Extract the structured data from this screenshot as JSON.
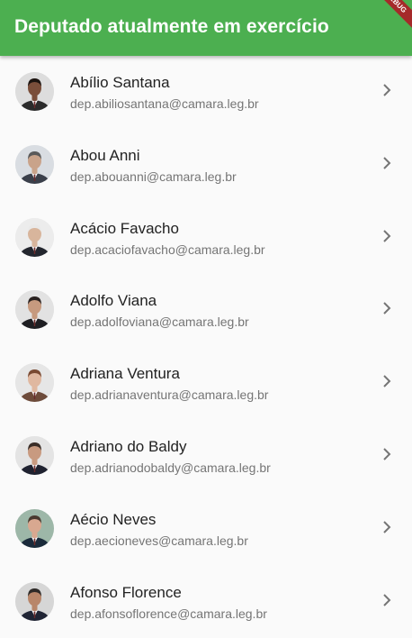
{
  "appbar": {
    "title": "Deputado atualmente em exercício",
    "debug_label": "DEBUG"
  },
  "colors": {
    "appbar": "#4caf50",
    "background": "#fafafa",
    "chevron": "#757575"
  },
  "deputies": [
    {
      "name": "Abílio Santana",
      "email": "dep.abiliosantana@camara.leg.br",
      "skin": "#7a4e3a",
      "hair": "#1c1410",
      "suit": "#2b2b2b",
      "bg": "#ddd"
    },
    {
      "name": "Abou Anni",
      "email": "dep.abouanni@camara.leg.br",
      "skin": "#c9a38a",
      "hair": "#5a5a5a",
      "suit": "#3a3f4a",
      "bg": "#d9dde2"
    },
    {
      "name": "Acácio Favacho",
      "email": "dep.acaciofavacho@camara.leg.br",
      "skin": "#d8b59c",
      "hair": "#e9e9e9",
      "suit": "#23262e",
      "bg": "#ececec"
    },
    {
      "name": "Adolfo Viana",
      "email": "dep.adolfoviana@camara.leg.br",
      "skin": "#c69a7f",
      "hair": "#2a2220",
      "suit": "#1e1e22",
      "bg": "#e2e2e2"
    },
    {
      "name": "Adriana Ventura",
      "email": "dep.adrianaventura@camara.leg.br",
      "skin": "#e0b8a0",
      "hair": "#7a4a32",
      "suit": "#6d4b3a",
      "bg": "#e6e6e6"
    },
    {
      "name": "Adriano do Baldy",
      "email": "dep.adrianodobaldy@camara.leg.br",
      "skin": "#c89a80",
      "hair": "#3a2e28",
      "suit": "#1f2230",
      "bg": "#e4e4e4"
    },
    {
      "name": "Aécio Neves",
      "email": "dep.aecioneves@camara.leg.br",
      "skin": "#d8a890",
      "hair": "#4a3a30",
      "suit": "#1a2a3a",
      "bg": "#9db7a8"
    },
    {
      "name": "Afonso Florence",
      "email": "dep.afonsoflorence@camara.leg.br",
      "skin": "#b8866a",
      "hair": "#2e2a28",
      "suit": "#202434",
      "bg": "#d6d6d6"
    }
  ],
  "chevron_icon": "chevron-right-icon"
}
